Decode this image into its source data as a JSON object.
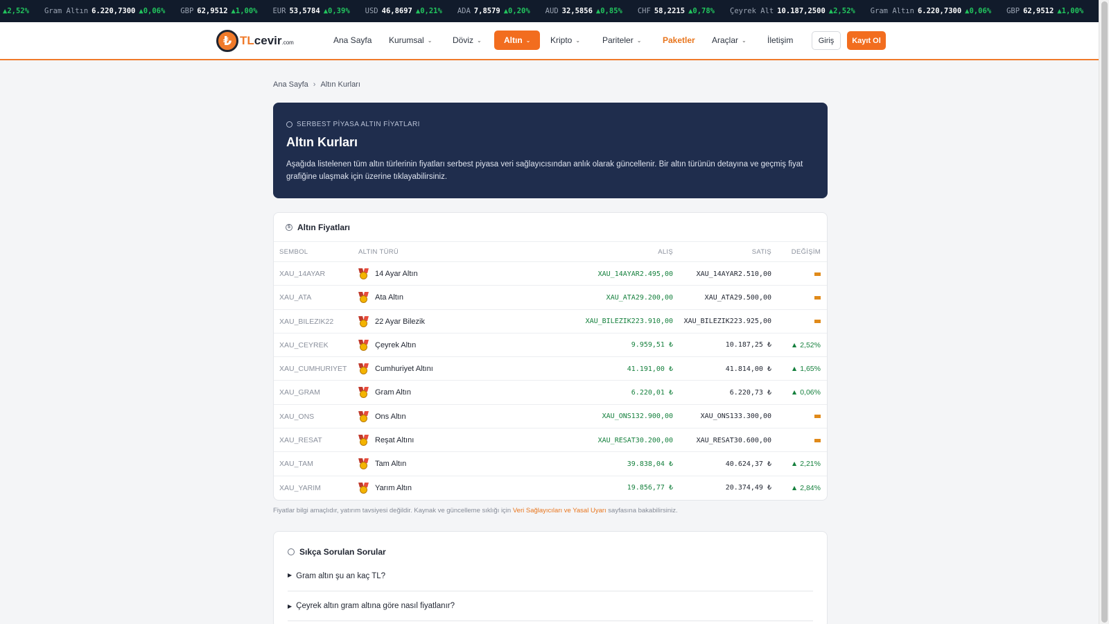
{
  "ticker": [
    {
      "sym": "",
      "val": "",
      "chg": "▲2,52%"
    },
    {
      "sym": "Gram Altın",
      "val": "6.220,7300",
      "chg": "▲0,06%"
    },
    {
      "sym": "GBP",
      "val": "62,9512",
      "chg": "▲1,00%"
    },
    {
      "sym": "EUR",
      "val": "53,5784",
      "chg": "▲0,39%"
    },
    {
      "sym": "USD",
      "val": "46,8697",
      "chg": "▲0,21%"
    },
    {
      "sym": "ADA",
      "val": "7,8579",
      "chg": "▲0,20%"
    },
    {
      "sym": "AUD",
      "val": "32,5856",
      "chg": "▲0,85%"
    },
    {
      "sym": "CHF",
      "val": "58,2215",
      "chg": "▲0,78%"
    },
    {
      "sym": "Çeyrek Alt",
      "val": "10.187,2500",
      "chg": "▲2,52%"
    },
    {
      "sym": "Gram Altın",
      "val": "6.220,7300",
      "chg": "▲0,06%"
    },
    {
      "sym": "GBP",
      "val": "62,9512",
      "chg": "▲1,00%"
    },
    {
      "sym": "EUR",
      "val": "53,5784",
      "chg": "▲0,39%"
    }
  ],
  "logo": {
    "mark": "₺",
    "a": "TL",
    "b": "cevir",
    "c": ".com"
  },
  "nav": {
    "home": "Ana Sayfa",
    "corporate": "Kurumsal",
    "currency": "Döviz",
    "gold": "Altın",
    "crypto": "Kripto",
    "parities": "Pariteler",
    "packages": "Paketler",
    "tools": "Araçlar",
    "contact": "İletişim",
    "chevron": "⌄",
    "login": "Giriş",
    "register": "Kayıt Ol"
  },
  "breadcrumb": {
    "home": "Ana Sayfa",
    "sep": "›",
    "current": "Altın Kurları"
  },
  "hero": {
    "eyebrow": "SERBEST PİYASA ALTIN FİYATLARI",
    "title": "Altın Kurları",
    "description": "Aşağıda listelenen tüm altın türlerinin fiyatları serbest piyasa veri sağlayıcısından anlık olarak güncellenir. Bir altın türünün detayına ve geçmiş fiyat grafiğine ulaşmak için üzerine tıklayabilirsiniz."
  },
  "table": {
    "title": "Altın Fiyatları",
    "headers": {
      "symbol": "SEMBOL",
      "type": "ALTIN TÜRÜ",
      "buy": "ALIŞ",
      "sell": "SATIŞ",
      "change": "DEĞİŞİM"
    },
    "rows": [
      {
        "symbol": "XAU_14AYAR",
        "name": "14 Ayar Altın",
        "buy": "XAU_14AYAR2.495,00",
        "sell": "XAU_14AYAR2.510,00",
        "change": ""
      },
      {
        "symbol": "XAU_ATA",
        "name": "Ata Altın",
        "buy": "XAU_ATA29.200,00",
        "sell": "XAU_ATA29.500,00",
        "change": ""
      },
      {
        "symbol": "XAU_BILEZIK22",
        "name": "22 Ayar Bilezik",
        "buy": "XAU_BILEZIK223.910,00",
        "sell": "XAU_BILEZIK223.925,00",
        "change": ""
      },
      {
        "symbol": "XAU_CEYREK",
        "name": "Çeyrek Altın",
        "buy": "9.959,51 ₺",
        "sell": "10.187,25 ₺",
        "change": "▲ 2,52%"
      },
      {
        "symbol": "XAU_CUMHURIYET",
        "name": "Cumhuriyet Altını",
        "buy": "41.191,00 ₺",
        "sell": "41.814,00 ₺",
        "change": "▲ 1,65%"
      },
      {
        "symbol": "XAU_GRAM",
        "name": "Gram Altın",
        "buy": "6.220,01 ₺",
        "sell": "6.220,73 ₺",
        "change": "▲ 0,06%"
      },
      {
        "symbol": "XAU_ONS",
        "name": "Ons Altın",
        "buy": "XAU_ONS132.900,00",
        "sell": "XAU_ONS133.300,00",
        "change": ""
      },
      {
        "symbol": "XAU_RESAT",
        "name": "Reşat Altını",
        "buy": "XAU_RESAT30.200,00",
        "sell": "XAU_RESAT30.600,00",
        "change": ""
      },
      {
        "symbol": "XAU_TAM",
        "name": "Tam Altın",
        "buy": "39.838,04 ₺",
        "sell": "40.624,37 ₺",
        "change": "▲ 2,21%"
      },
      {
        "symbol": "XAU_YARIM",
        "name": "Yarım Altın",
        "buy": "19.856,77 ₺",
        "sell": "20.374,49 ₺",
        "change": "▲ 2,84%"
      }
    ]
  },
  "disclaimer": {
    "before": "Fiyatlar bilgi amaçlıdır, yatırım tavsiyesi değildir. Kaynak ve güncelleme sıklığı için ",
    "link": "Veri Sağlayıcıları ve Yasal Uyarı",
    "after": " sayfasına bakabilirsiniz."
  },
  "faq": {
    "title": "Sıkça Sorulan Sorular",
    "items": [
      "Gram altın şu an kaç TL?",
      "Çeyrek altın gram altına göre nasıl fiyatlanır?"
    ]
  },
  "colors": {
    "accent": "#f26d1f",
    "hero_bg": "#1f2d4d",
    "ticker_bg": "#111b2b",
    "up": "#22c55e",
    "flat": "#e08a1a"
  }
}
